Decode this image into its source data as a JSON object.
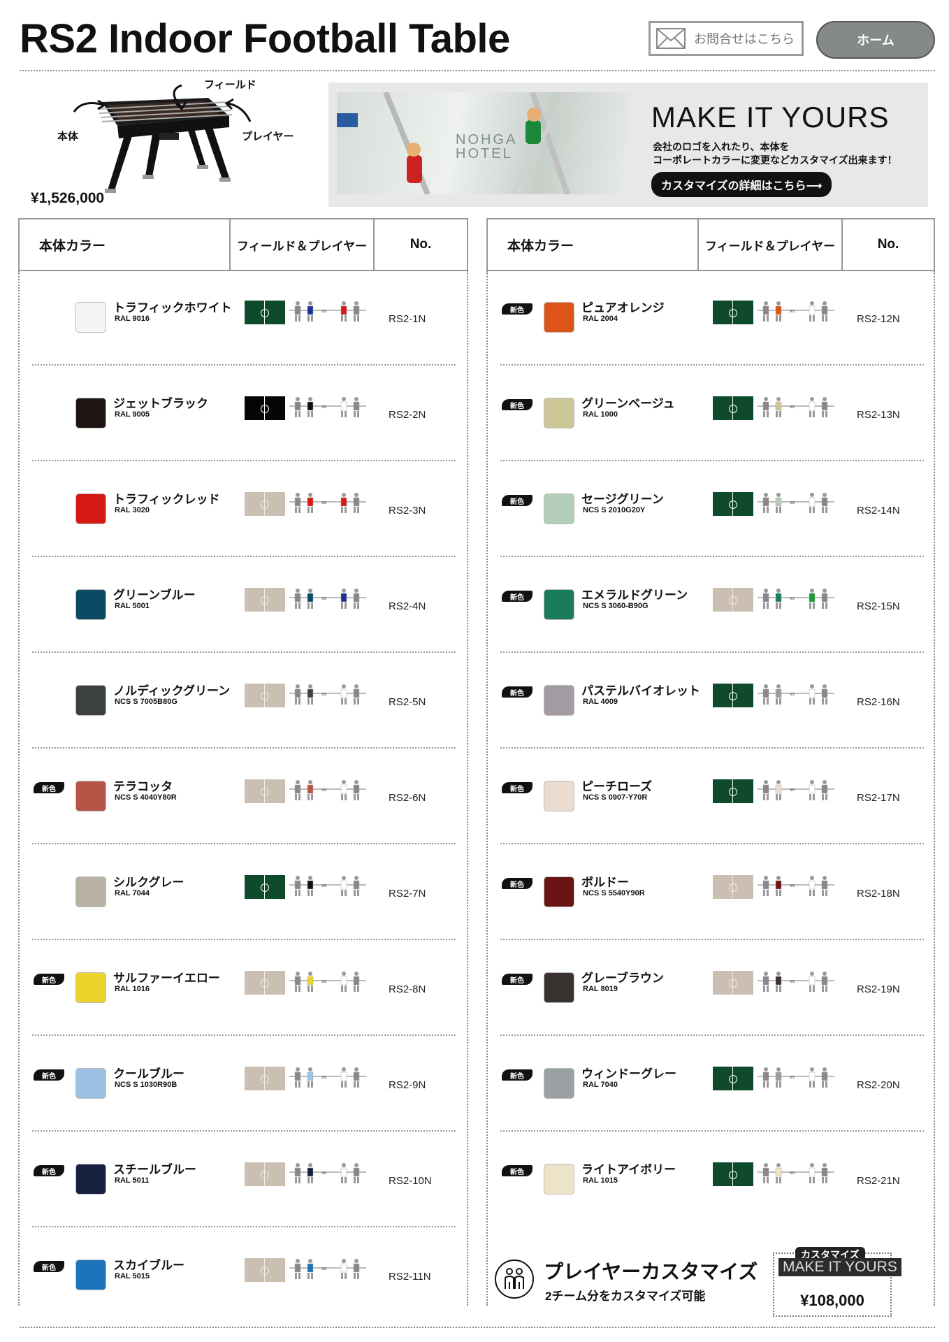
{
  "header": {
    "title": "RS2 Indoor Football Table",
    "contact_label": "お問合せはこちら",
    "home_label": "ホーム"
  },
  "hero": {
    "label_field": "フィールド",
    "label_body": "本体",
    "label_player": "プレイヤー",
    "price": "¥1,526,000"
  },
  "banner": {
    "hotel_line1": "NOHGA",
    "hotel_line2": "HOTEL",
    "headline": "MAKE IT YOURS",
    "sub1": "会社のロゴを入れたり、本体を",
    "sub2": "コーポレートカラーに変更などカスタマイズ出来ます！",
    "cta": "カスタマイズの詳細はこちら⟶"
  },
  "table_header": {
    "col_body": "本体カラー",
    "col_field": "フィールド＆プレイヤー",
    "col_no": "No."
  },
  "colors": {
    "dark_green_field": "#0e4a2c",
    "beige_field": "#cbbfb2",
    "black_field": "#050505"
  },
  "left_rows": [
    {
      "badge": "",
      "name": "トラフィックホワイト",
      "code": "RAL 9016",
      "swatch": "#f5f5f3",
      "field": "green",
      "team1": "#20309a",
      "team2": "#d01818",
      "no": "RS2-1N"
    },
    {
      "badge": "",
      "name": "ジェットブラック",
      "code": "RAL 9005",
      "swatch": "#1e1412",
      "field": "black",
      "team1": "#111111",
      "team2": "#ffffff",
      "no": "RS2-2N"
    },
    {
      "badge": "",
      "name": "トラフィックレッド",
      "code": "RAL 3020",
      "swatch": "#d41a12",
      "field": "beige",
      "team1": "#d41a12",
      "team2": "#d41a12",
      "no": "RS2-3N"
    },
    {
      "badge": "",
      "name": "グリーンブルー",
      "code": "RAL 5001",
      "swatch": "#0a4a63",
      "field": "beige",
      "team1": "#0a4a63",
      "team2": "#20309a",
      "no": "RS2-4N"
    },
    {
      "badge": "",
      "name": "ノルディックグリーン",
      "code": "NCS S 7005B80G",
      "swatch": "#3a413f",
      "field": "beige",
      "team1": "#3a413f",
      "team2": "#ffffff",
      "no": "RS2-5N"
    },
    {
      "badge": "新色",
      "name": "テラコッタ",
      "code": "NCS S 4040Y80R",
      "swatch": "#b55548",
      "field": "beige",
      "team1": "#b55548",
      "team2": "#ffffff",
      "no": "RS2-6N"
    },
    {
      "badge": "",
      "name": "シルクグレー",
      "code": "RAL 7044",
      "swatch": "#b8b2a4",
      "field": "green",
      "team1": "#111111",
      "team2": "#ffffff",
      "no": "RS2-7N"
    },
    {
      "badge": "新色",
      "name": "サルファーイエロー",
      "code": "RAL 1016",
      "swatch": "#ecd42c",
      "field": "beige",
      "team1": "#ecd42c",
      "team2": "#ffffff",
      "no": "RS2-8N"
    },
    {
      "badge": "新色",
      "name": "クールブルー",
      "code": "NCS S 1030R90B",
      "swatch": "#9cc2e3",
      "field": "beige",
      "team1": "#9cc2e3",
      "team2": "#ffffff",
      "no": "RS2-9N"
    },
    {
      "badge": "新色",
      "name": "スチールブルー",
      "code": "RAL 5011",
      "swatch": "#182040",
      "field": "beige",
      "team1": "#182040",
      "team2": "#ffffff",
      "no": "RS2-10N"
    },
    {
      "badge": "新色",
      "name": "スカイブルー",
      "code": "RAL 5015",
      "swatch": "#1e74ba",
      "field": "beige",
      "team1": "#1e74ba",
      "team2": "#ffffff",
      "no": "RS2-11N"
    }
  ],
  "right_rows": [
    {
      "badge": "新色",
      "name": "ピュアオレンジ",
      "code": "RAL 2004",
      "swatch": "#dd5418",
      "field": "green",
      "team1": "#dd5418",
      "team2": "#ffffff",
      "no": "RS2-12N"
    },
    {
      "badge": "新色",
      "name": "グリーンベージュ",
      "code": "RAL 1000",
      "swatch": "#cdc696",
      "field": "green",
      "team1": "#cdc696",
      "team2": "#ffffff",
      "no": "RS2-13N"
    },
    {
      "badge": "新色",
      "name": "セージグリーン",
      "code": "NCS S 2010G20Y",
      "swatch": "#b3ceb8",
      "field": "green",
      "team1": "#b3ceb8",
      "team2": "#ffffff",
      "no": "RS2-14N"
    },
    {
      "badge": "新色",
      "name": "エメラルドグリーン",
      "code": "NCS S 3060-B90G",
      "swatch": "#1b7c5a",
      "field": "beige",
      "team1": "#1b7c5a",
      "team2": "#1b9a3a",
      "no": "RS2-15N"
    },
    {
      "badge": "新色",
      "name": "パステルバイオレット",
      "code": "RAL 4009",
      "swatch": "#a49aa3",
      "field": "green",
      "team1": "#a49aa3",
      "team2": "#ffffff",
      "no": "RS2-16N"
    },
    {
      "badge": "新色",
      "name": "ピーチローズ",
      "code": "NCS S 0907-Y70R",
      "swatch": "#eadccf",
      "field": "green",
      "team1": "#eadccf",
      "team2": "#ffffff",
      "no": "RS2-17N"
    },
    {
      "badge": "新色",
      "name": "ボルドー",
      "code": "NCS S 5540Y90R",
      "swatch": "#6a1416",
      "field": "beige",
      "team1": "#6a1416",
      "team2": "#ffffff",
      "no": "RS2-18N"
    },
    {
      "badge": "新色",
      "name": "グレーブラウン",
      "code": "RAL 8019",
      "swatch": "#3a3230",
      "field": "beige",
      "team1": "#3a3230",
      "team2": "#ffffff",
      "no": "RS2-19N"
    },
    {
      "badge": "新色",
      "name": "ウィンドーグレー",
      "code": "RAL 7040",
      "swatch": "#9aa1a3",
      "field": "green",
      "team1": "#9aa1a3",
      "team2": "#ffffff",
      "no": "RS2-20N"
    },
    {
      "badge": "新色",
      "name": "ライトアイボリー",
      "code": "RAL 1015",
      "swatch": "#ede3c6",
      "field": "green",
      "team1": "#ede3c6",
      "team2": "#ffffff",
      "no": "RS2-21N"
    }
  ],
  "customize": {
    "icon": "players-icon",
    "title": "プレイヤーカスタマイズ",
    "subtitle": "2チーム分をカスタマイズ可能",
    "tag1": "カスタマイズ",
    "tag2": "MAKE IT YOURS",
    "price": "¥108,000"
  }
}
